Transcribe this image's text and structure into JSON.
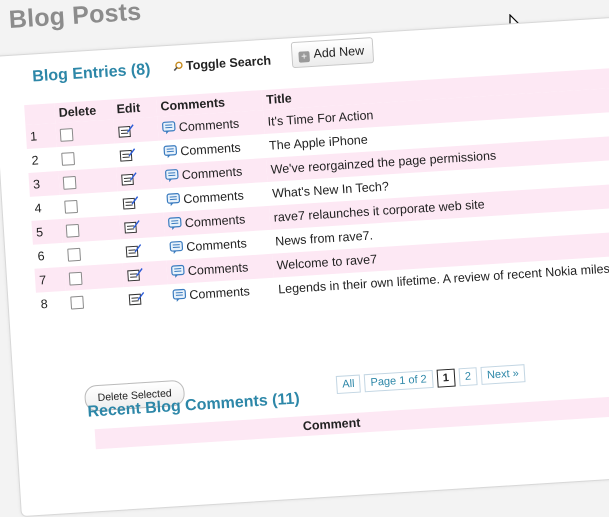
{
  "page": {
    "title": "Blog Posts"
  },
  "entries": {
    "title": "Blog Entries (8)",
    "toggle_search": "Toggle Search",
    "add_new": "Add New",
    "columns": {
      "delete": "Delete",
      "edit": "Edit",
      "comments": "Comments",
      "title": "Title"
    },
    "rows": [
      {
        "num": "1",
        "comments": "Comments",
        "title": "It's Time For Action"
      },
      {
        "num": "2",
        "comments": "Comments",
        "title": "The Apple iPhone"
      },
      {
        "num": "3",
        "comments": "Comments",
        "title": "We've reorgainzed the page permissions"
      },
      {
        "num": "4",
        "comments": "Comments",
        "title": "What's New In Tech?"
      },
      {
        "num": "5",
        "comments": "Comments",
        "title": "rave7 relaunches it corporate web site"
      },
      {
        "num": "6",
        "comments": "Comments",
        "title": "News from rave7."
      },
      {
        "num": "7",
        "comments": "Comments",
        "title": "Welcome to rave7"
      },
      {
        "num": "8",
        "comments": "Comments",
        "title": "Legends in their own lifetime. A review of recent Nokia milestones"
      }
    ],
    "delete_selected": "Delete Selected"
  },
  "pager": {
    "all": "All",
    "info": "Page 1 of 2",
    "page1": "1",
    "page2": "2",
    "next": "Next »"
  },
  "recent_comments": {
    "title": "Recent Blog Comments (11)",
    "column_comment": "Comment"
  },
  "colors": {
    "accent": "#2d87a8",
    "row_stripe": "#fde8f4",
    "title_gray": "#8c8c8c"
  },
  "icons": [
    "cursor-arrow-icon",
    "magnifier-icon",
    "plus-icon",
    "edit-icon",
    "comment-bubble-icon"
  ]
}
